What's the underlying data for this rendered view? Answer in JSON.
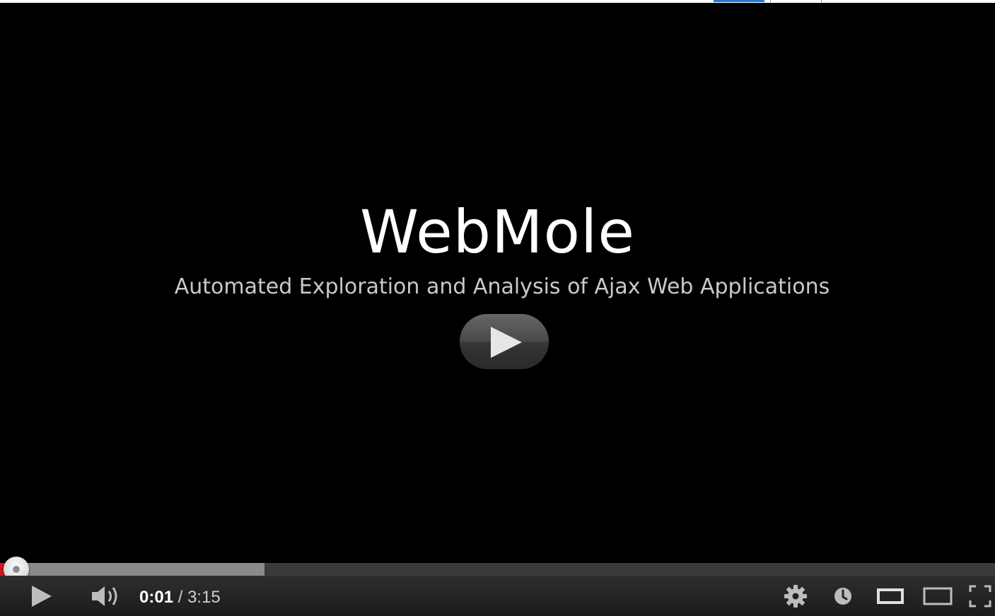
{
  "video": {
    "title": "WebMole",
    "subtitle": "Automated Exploration and Analysis of Ajax Web Applications"
  },
  "player": {
    "current_time": "0:01",
    "separator": " / ",
    "duration": "3:15",
    "progress": {
      "played_fraction": 0.005,
      "buffered_fraction": 0.266
    },
    "colors": {
      "played": "#cc181e",
      "buffered": "#8a8a8a",
      "track": "#3b3b3b",
      "controls_bg": "#1b1b1b"
    },
    "icons": {
      "big_play": "play-icon",
      "play": "play-icon",
      "volume": "volume-icon",
      "settings": "gear-icon",
      "watch_later": "clock-icon",
      "small_player": "small-player-icon",
      "large_player": "large-player-icon",
      "fullscreen": "fullscreen-icon"
    }
  }
}
